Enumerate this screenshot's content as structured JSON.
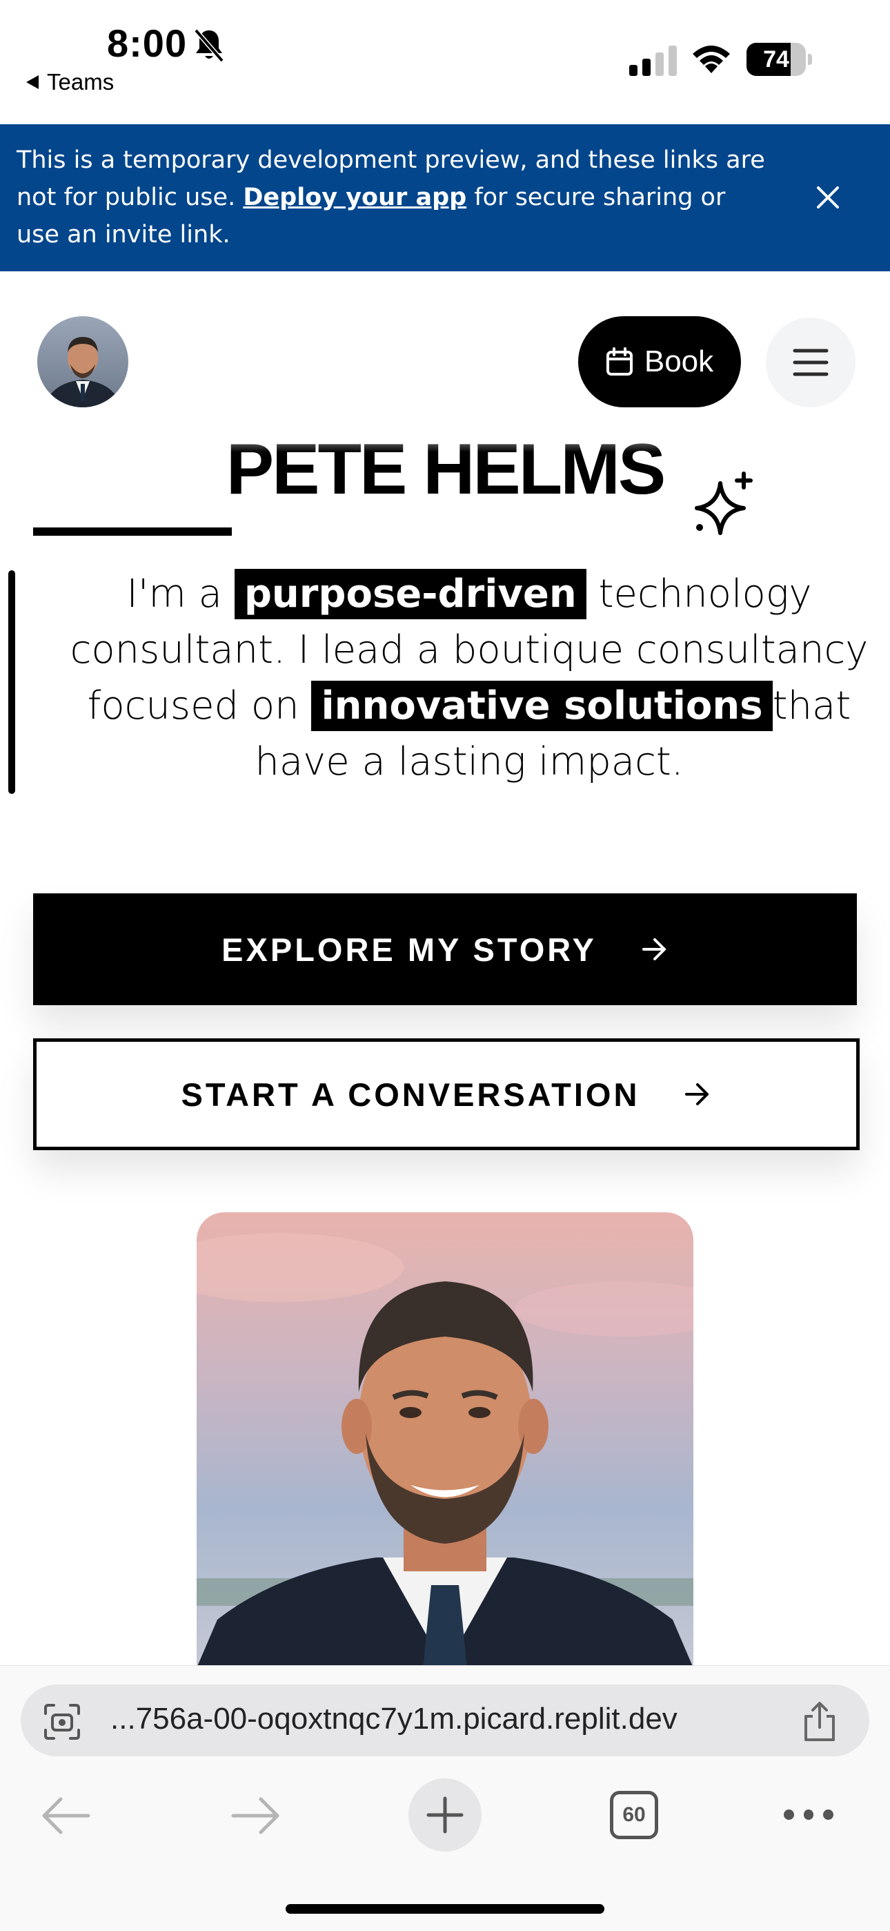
{
  "status_bar": {
    "time": "8:00",
    "back_app": "Teams",
    "battery": "74",
    "battery_level": 0.74
  },
  "banner": {
    "text_before": "This is a temporary development preview, and these links are not for public use. ",
    "link": "Deploy your app",
    "text_after": " for secure sharing or use an invite link."
  },
  "header": {
    "book_label": "Book"
  },
  "hero": {
    "name": "PETE HELMS",
    "intro_part1": "I'm a ",
    "highlight1": "purpose-driven",
    "intro_part2": " technology consultant. I lead a boutique consultancy focused on ",
    "highlight2": "innovative solutions",
    "intro_part3": "that have a lasting impact."
  },
  "cta": {
    "explore_label": "EXPLORE MY STORY",
    "conversation_label": "START A CONVERSATION"
  },
  "browser": {
    "url": "...756a-00-oqoxtnqc7y1m.picard.replit.dev",
    "tab_count": "60"
  },
  "colors": {
    "banner_bg": "#03468c",
    "primary": "#000000",
    "background": "#ffffff"
  }
}
